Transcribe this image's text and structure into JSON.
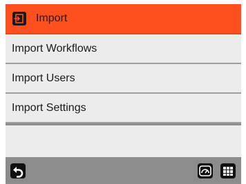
{
  "header": {
    "title": "Import",
    "icon": "import-icon",
    "color": "#fe4f1f"
  },
  "items": [
    {
      "label": "Import Workflows"
    },
    {
      "label": "Import Users"
    },
    {
      "label": "Import Settings"
    }
  ],
  "footer": {
    "back_icon": "back-icon",
    "dashboard_icon": "dashboard-icon",
    "apps_icon": "apps-grid-icon"
  }
}
